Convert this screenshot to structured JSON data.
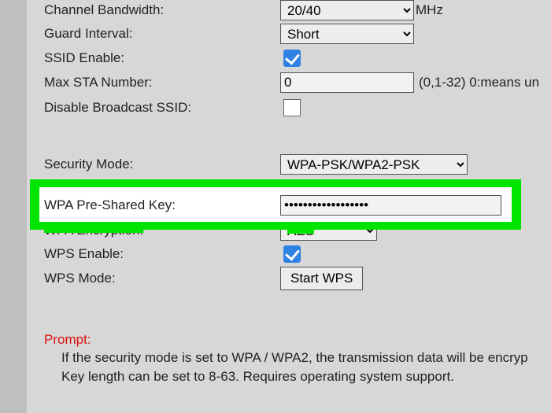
{
  "rows": {
    "bandwidth": {
      "label": "Channel Bandwidth:",
      "value": "20/40",
      "unit": "MHz"
    },
    "guard": {
      "label": "Guard Interval:",
      "value": "Short"
    },
    "ssid": {
      "label": "SSID Enable:"
    },
    "maxsta": {
      "label": "Max STA Number:",
      "value": "0",
      "hint": "(0,1-32) 0:means un"
    },
    "disbcast": {
      "label": "Disable Broadcast SSID:"
    },
    "secmode": {
      "label": "Security Mode:",
      "value": "WPA-PSK/WPA2-PSK"
    },
    "psk": {
      "label": "WPA Pre-Shared Key:",
      "value": "••••••••••••••••••"
    },
    "encr": {
      "label": "WPA Encryption:",
      "value": "AES"
    },
    "wpsen": {
      "label": "WPS Enable:"
    },
    "wpsmode": {
      "label": "WPS Mode:",
      "button": "Start WPS"
    }
  },
  "prompt": {
    "title": "Prompt:",
    "body": "If the security mode is set to WPA / WPA2, the transmission data will be encryp\nKey length can be set to 8-63. Requires operating system support."
  }
}
